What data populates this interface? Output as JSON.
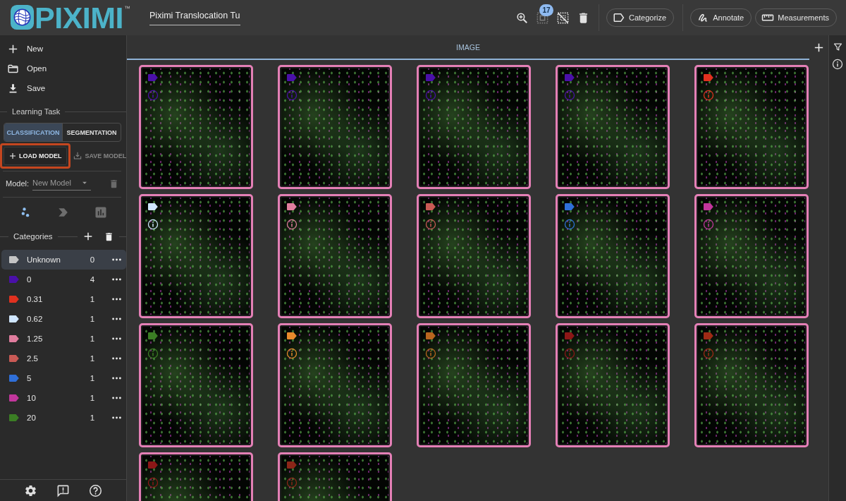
{
  "header": {
    "logo": {
      "text": "PIXIMI",
      "trademark": "™"
    },
    "project_name": "Piximi Translocation Tu",
    "tools": [
      {
        "disabled": false
      },
      {
        "disabled": true,
        "badge": "17"
      },
      {
        "disabled": false
      },
      {
        "disabled": false
      }
    ],
    "buttons": [
      "Categorize",
      "Annotate",
      "Measurements"
    ]
  },
  "sidebar": {
    "file_menu": [
      "New",
      "Open",
      "Save"
    ],
    "learning_task": {
      "heading": "Learning Task",
      "tabs": [
        {
          "label": "CLASSIFICATION",
          "selected": true
        },
        {
          "label": "SEGMENTATION",
          "selected": false
        }
      ],
      "load_model": {
        "label": "LOAD MODEL",
        "highlighted": true
      },
      "save_model": {
        "label": "SAVE MODEL",
        "disabled": true
      }
    },
    "model": {
      "label": "Model:",
      "value": "New Model"
    },
    "views": [
      {
        "selected": true
      },
      {
        "selected": false
      },
      {
        "selected": false
      }
    ],
    "categories": {
      "heading": "Categories",
      "items": [
        {
          "name": "Unknown",
          "count": "0",
          "color": "#c4c4c4",
          "selected": true
        },
        {
          "name": "0",
          "count": "4",
          "color": "#4a10a8",
          "selected": false
        },
        {
          "name": "0.31",
          "count": "1",
          "color": "#e0311f",
          "selected": false
        },
        {
          "name": "0.62",
          "count": "1",
          "color": "#cfe6ff",
          "selected": false
        },
        {
          "name": "1.25",
          "count": "1",
          "color": "#e07d9e",
          "selected": false
        },
        {
          "name": "2.5",
          "count": "1",
          "color": "#c95a55",
          "selected": false
        },
        {
          "name": "5",
          "count": "1",
          "color": "#2f6fd8",
          "selected": false
        },
        {
          "name": "10",
          "count": "1",
          "color": "#c2369c",
          "selected": false
        },
        {
          "name": "20",
          "count": "1",
          "color": "#3b7e24",
          "selected": false
        }
      ]
    }
  },
  "main": {
    "tab": {
      "label": "IMAGE",
      "selected": true
    },
    "images": [
      {
        "color": "#4a10a8",
        "selected": true
      },
      {
        "color": "#4a10a8",
        "selected": true
      },
      {
        "color": "#4a10a8",
        "selected": true
      },
      {
        "color": "#4a10a8",
        "selected": true
      },
      {
        "color": "#e0311f",
        "selected": true
      },
      {
        "color": "#cfe6ff",
        "selected": true
      },
      {
        "color": "#e07d9e",
        "selected": true
      },
      {
        "color": "#c95a55",
        "selected": true
      },
      {
        "color": "#2f6fd8",
        "selected": true
      },
      {
        "color": "#c2369c",
        "selected": true
      },
      {
        "color": "#3b7e24",
        "selected": true
      },
      {
        "color": "#e88a2c",
        "selected": true
      },
      {
        "color": "#b8661f",
        "selected": true
      },
      {
        "color": "#8c1717",
        "selected": true
      },
      {
        "color": "#9e2a15",
        "selected": true
      },
      {
        "color": "#8c1717",
        "selected": true
      },
      {
        "color": "#8c2618",
        "selected": true
      }
    ]
  }
}
